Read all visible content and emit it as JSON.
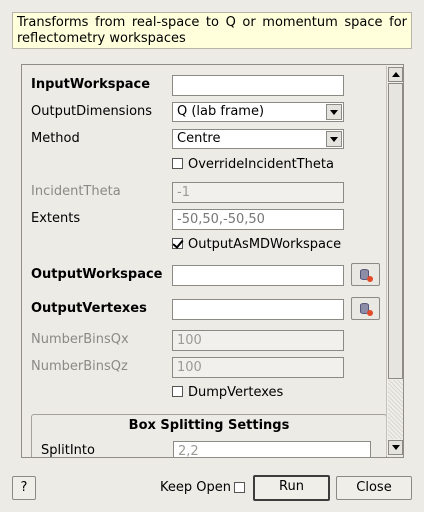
{
  "description": "Transforms from real-space to Q or momentum space for reflectometry workspaces",
  "form": {
    "input_workspace": {
      "label": "InputWorkspace",
      "value": ""
    },
    "output_dimensions": {
      "label": "OutputDimensions",
      "value": "Q (lab frame)"
    },
    "method": {
      "label": "Method",
      "value": "Centre"
    },
    "override_incident_theta": {
      "label": "OverrideIncidentTheta",
      "checked": false
    },
    "incident_theta": {
      "label": "IncidentTheta",
      "value": "-1"
    },
    "extents": {
      "label": "Extents",
      "value": "-50,50,-50,50"
    },
    "output_as_md_workspace": {
      "label": "OutputAsMDWorkspace",
      "checked": true
    },
    "output_workspace": {
      "label": "OutputWorkspace",
      "value": ""
    },
    "output_vertexes": {
      "label": "OutputVertexes",
      "value": ""
    },
    "number_bins_qx": {
      "label": "NumberBinsQx",
      "value": "100"
    },
    "number_bins_qz": {
      "label": "NumberBinsQz",
      "value": "100"
    },
    "dump_vertexes": {
      "label": "DumpVertexes",
      "checked": false
    },
    "box_splitting": {
      "title": "Box Splitting Settings",
      "split_into_label": "SplitInto",
      "split_into_value": "2,2"
    }
  },
  "footer": {
    "help_label": "?",
    "keep_open_label": "Keep Open",
    "keep_open_checked": false,
    "run_label": "Run",
    "close_label": "Close"
  },
  "icons": {
    "browse": "database-icon",
    "scroll_up": "triangle-up-icon",
    "scroll_down": "triangle-down-icon",
    "combo_arrow": "triangle-down-icon"
  },
  "colors": {
    "window_bg": "#ecebe6",
    "tooltip_bg": "#ffffdc",
    "disabled_text": "#8a8a86"
  }
}
